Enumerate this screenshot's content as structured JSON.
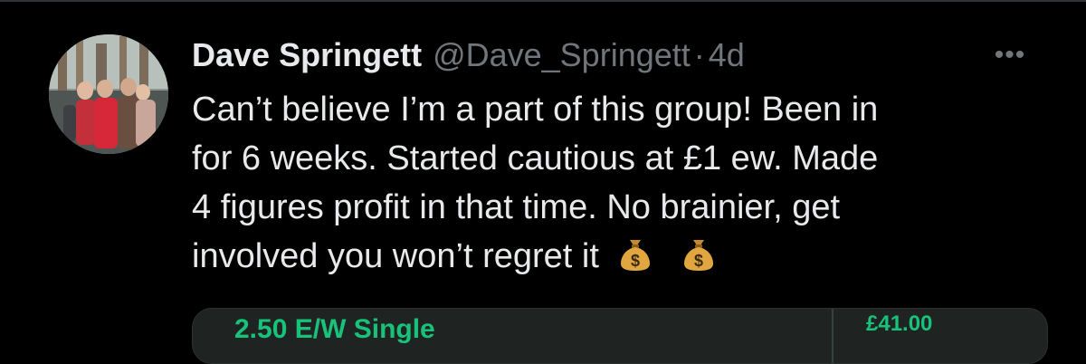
{
  "tweet": {
    "author": {
      "display_name": "Dave Springett",
      "handle": "@Dave_Springett",
      "separator": "·",
      "timestamp": "4d"
    },
    "more_label": "•••",
    "lines": [
      "Can’t believe I’m a part of this group!  Been in",
      "for 6 weeks.  Started cautious at £1 ew.  Made",
      "4 figures profit in that time.  No brainier, get",
      "involved you won’t regret it"
    ],
    "emojis": [
      "money-bag-icon",
      "money-bag-icon"
    ]
  },
  "bet_card": {
    "title": "2.50 E/W Single",
    "amount": "£41.00"
  },
  "colors": {
    "background": "#000000",
    "text_primary": "#e7e9ea",
    "text_secondary": "#71767b",
    "accent_green": "#19c27a"
  }
}
